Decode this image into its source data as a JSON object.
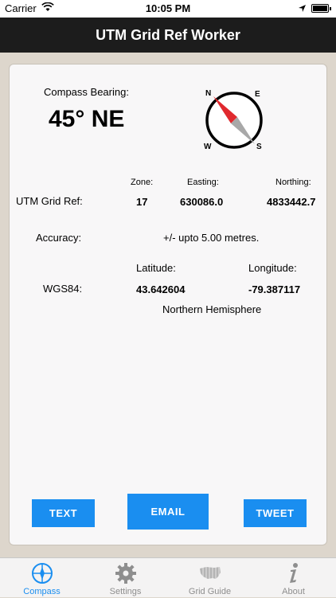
{
  "status_bar": {
    "carrier": "Carrier",
    "time": "10:05 PM"
  },
  "nav": {
    "title": "UTM Grid Ref Worker"
  },
  "compass": {
    "bearing_label": "Compass Bearing:",
    "bearing_value": "45° NE",
    "letters": {
      "n": "N",
      "e": "E",
      "s": "S",
      "w": "W"
    }
  },
  "utm": {
    "zone_header": "Zone:",
    "easting_header": "Easting:",
    "northing_header": "Northing:",
    "label": "UTM Grid Ref:",
    "zone": "17",
    "easting": "630086.0",
    "northing": "4833442.7"
  },
  "accuracy": {
    "label": "Accuracy:",
    "value": "+/- upto 5.00 metres."
  },
  "wgs84": {
    "lat_header": "Latitude:",
    "lon_header": "Longitude:",
    "label": "WGS84:",
    "lat": "43.642604",
    "lon": "-79.387117",
    "hemisphere": "Northern Hemisphere"
  },
  "buttons": {
    "text": "TEXT",
    "email": "EMAIL",
    "tweet": "TWEET"
  },
  "tabs": [
    {
      "label": "Compass",
      "icon": "compass-icon",
      "active": true
    },
    {
      "label": "Settings",
      "icon": "gear-icon",
      "active": false
    },
    {
      "label": "Grid Guide",
      "icon": "usa-grid-icon",
      "active": false
    },
    {
      "label": "About",
      "icon": "info-icon",
      "active": false
    }
  ],
  "colors": {
    "accent": "#1a8ef0",
    "nav_bg": "#1c1c1c",
    "needle_red": "#e0292e"
  }
}
